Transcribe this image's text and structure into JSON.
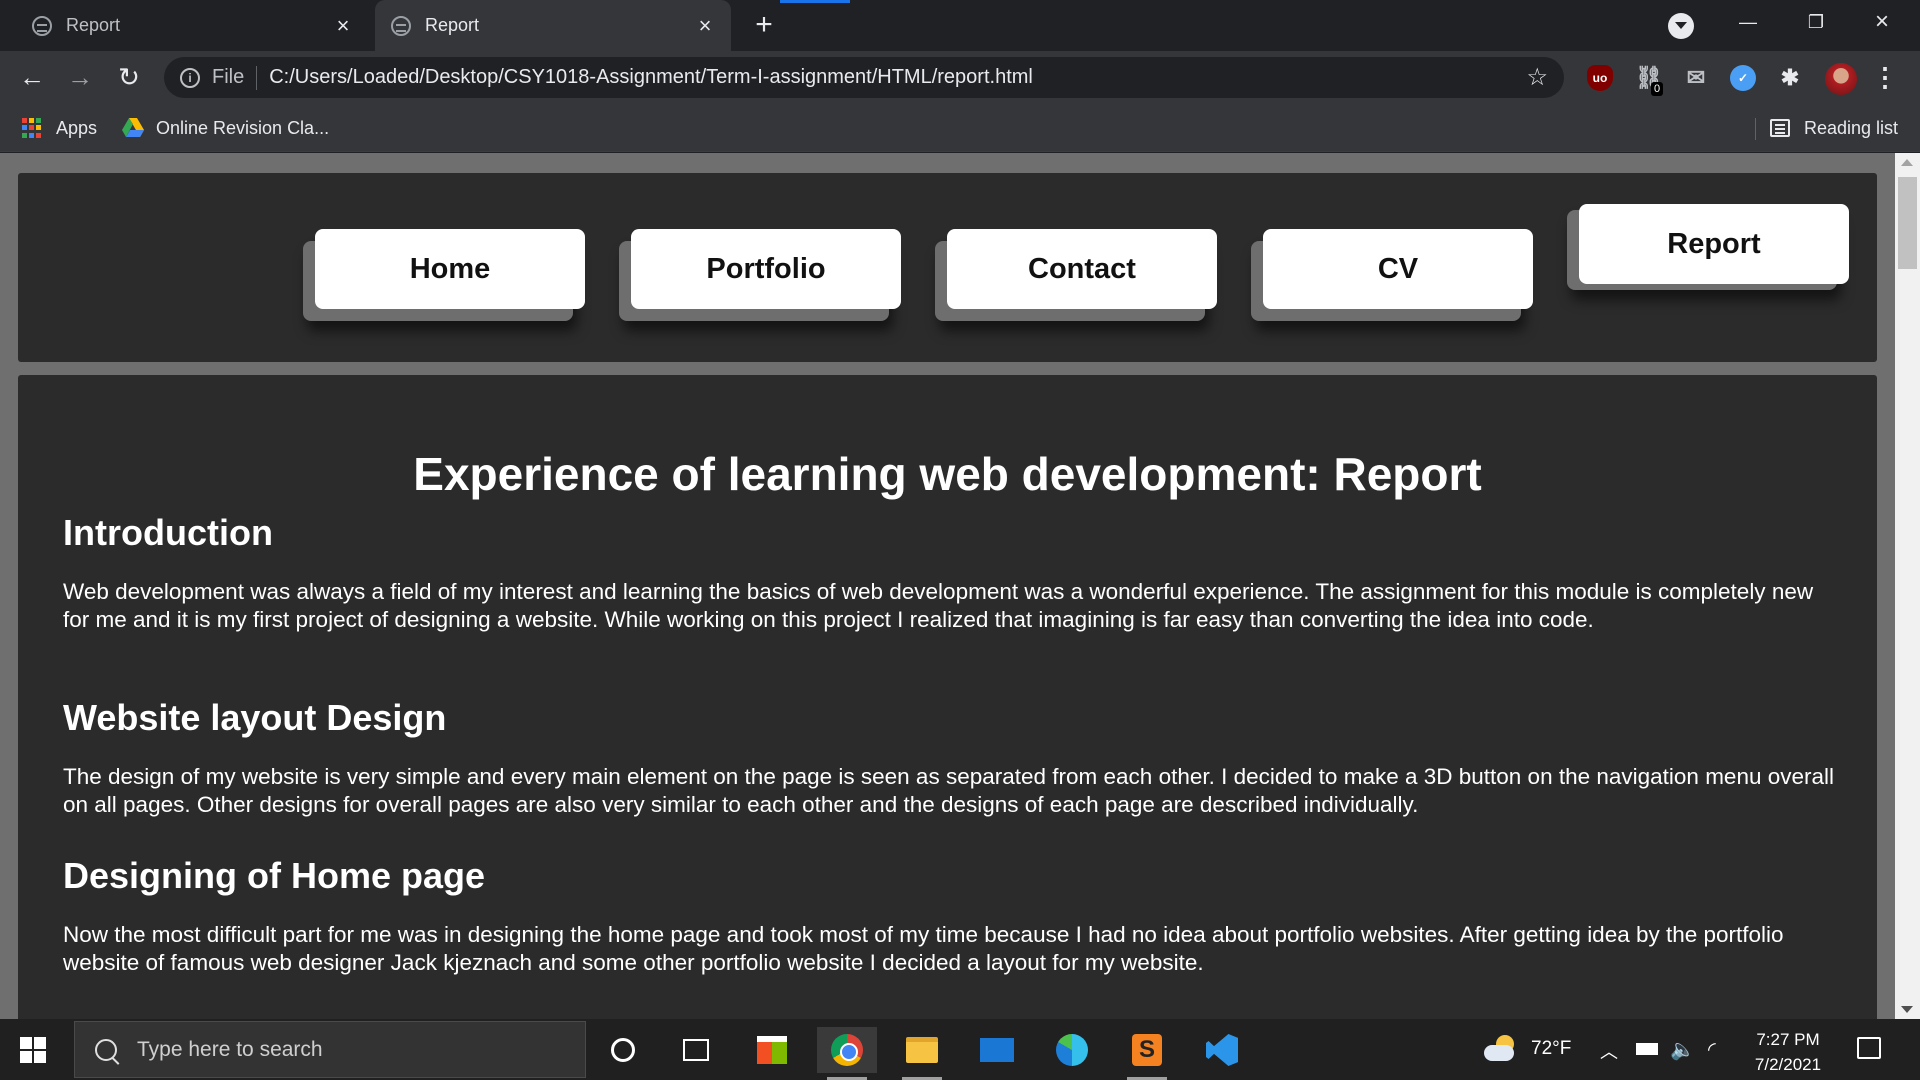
{
  "browser": {
    "tabs": [
      {
        "title": "Report",
        "active": false
      },
      {
        "title": "Report",
        "active": true
      }
    ],
    "address": {
      "scheme_label": "File",
      "url": "C:/Users/Loaded/Desktop/CSY1018-Assignment/Term-I-assignment/HTML/report.html"
    },
    "extensions": {
      "ublock_label": "uo",
      "link_badge": "0"
    },
    "bookmarks": [
      {
        "label": "Apps",
        "icon": "apps-grid-icon"
      },
      {
        "label": "Online Revision Cla...",
        "icon": "google-drive-icon"
      }
    ],
    "reading_list": "Reading list",
    "colors": {
      "chrome_bg": "#202124",
      "toolbar_bg": "#35363a",
      "accent": "#1a73e8"
    }
  },
  "site": {
    "nav": [
      {
        "label": "Home",
        "active": false
      },
      {
        "label": "Portfolio",
        "active": false
      },
      {
        "label": "Contact",
        "active": false
      },
      {
        "label": "CV",
        "active": false
      },
      {
        "label": "Report",
        "active": true
      }
    ],
    "title": "Experience of learning web development: Report",
    "sections": [
      {
        "heading": "Introduction",
        "body": "Web development was always a field of my interest and learning the basics of web development was a wonderful experience. The assignment for this module is completely new for me and it is my first project of designing a website. While working on this project I realized that imagining is far easy than converting the idea into code."
      },
      {
        "heading": "Website layout Design",
        "body": "The design of my website is very simple and every main element on the page is seen as separated from each other. I decided to make a 3D button on the navigation menu overall on all pages. Other designs for overall pages are also very similar to each other and the designs of each page are described individually."
      },
      {
        "heading": "Designing of Home page",
        "body": "Now the most difficult part for me was in designing the home page and took most of my time because I had no idea about portfolio websites. After getting idea by the portfolio website of famous web designer Jack kjeznach and some other portfolio website I decided a layout for my website."
      }
    ],
    "colors": {
      "page_bg": "#6f6f6f",
      "panel_bg": "#2b2b2b",
      "text": "#ffffff",
      "button_face": "#ffffff"
    }
  },
  "taskbar": {
    "search_placeholder": "Type here to search",
    "pinned": [
      "cortana-icon",
      "task-view-icon",
      "store-icon",
      "chrome-icon",
      "file-explorer-icon",
      "mail-icon",
      "edge-icon",
      "sublime-text-icon",
      "vscode-icon"
    ],
    "weather": {
      "temp": "72°F"
    },
    "clock": {
      "time": "7:27 PM",
      "date": "7/2/2021"
    }
  }
}
